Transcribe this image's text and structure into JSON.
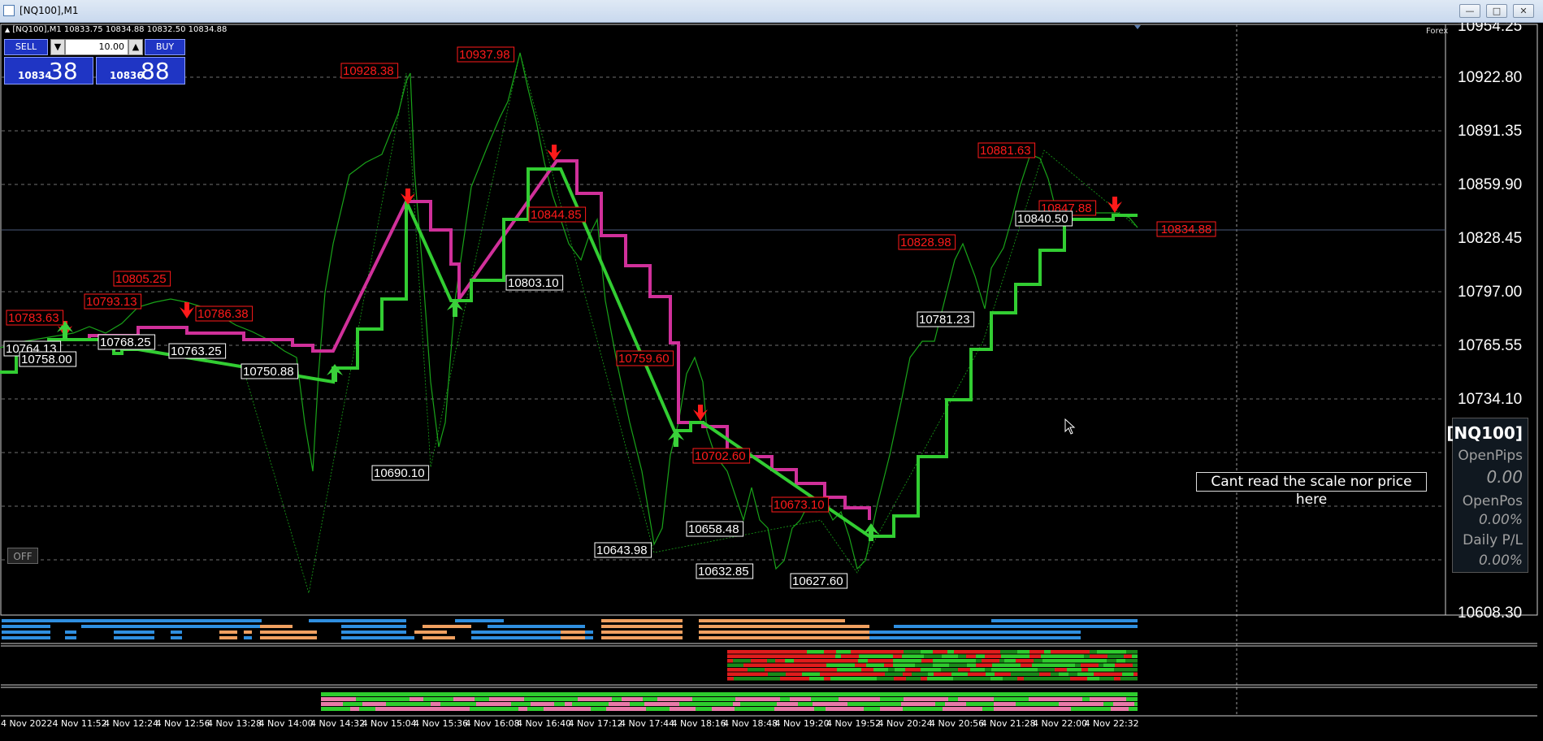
{
  "window": {
    "title": "[NQ100],M1"
  },
  "chart": {
    "header": "[NQ100],M1  10833.75 10834.88 10832.50 10834.88",
    "corner_label": "Forex"
  },
  "trade_panel": {
    "sell_label": "SELL",
    "buy_label": "BUY",
    "lot_size": "10.00",
    "bid_small": "10834",
    "bid_big": "38",
    "ask_small": "10836",
    "ask_big": "88"
  },
  "price_axis": {
    "top_partial": "10954.25",
    "labels": [
      "10922.80",
      "10891.35",
      "10859.90",
      "10828.45",
      "10797.00",
      "10765.55",
      "10734.10"
    ],
    "bottom_partial": "10608.30",
    "current_price": "10834.88"
  },
  "time_axis": {
    "labels": [
      "4 Nov 2022",
      "4 Nov 11:52",
      "4 Nov 12:24",
      "4 Nov 12:56",
      "4 Nov 13:28",
      "4 Nov 14:00",
      "4 Nov 14:32",
      "4 Nov 15:04",
      "4 Nov 15:36",
      "4 Nov 16:08",
      "4 Nov 16:40",
      "4 Nov 17:12",
      "4 Nov 17:44",
      "4 Nov 18:16",
      "4 Nov 18:48",
      "4 Nov 19:20",
      "4 Nov 19:52",
      "4 Nov 20:24",
      "4 Nov 20:56",
      "4 Nov 21:28",
      "4 Nov 22:00",
      "4 Nov 22:32"
    ]
  },
  "high_labels": [
    "10928.38",
    "10937.98",
    "10805.25",
    "10793.13",
    "10783.63",
    "10786.38",
    "10844.85",
    "10759.60",
    "10702.60",
    "10673.10",
    "10881.63",
    "10828.98",
    "10847.88"
  ],
  "low_labels": [
    "10764.13",
    "10768.25",
    "10758.00",
    "10763.25",
    "10750.88",
    "10690.10",
    "10803.10",
    "10643.98",
    "10658.48",
    "10632.85",
    "10627.60",
    "10781.23",
    "10840.50"
  ],
  "info_panel": {
    "symbol": "[NQ100]",
    "open_pips_label": "OpenPips",
    "open_pips_value": "0.00",
    "open_pos_label": "OpenPos",
    "open_pos_value": "0.00%",
    "daily_pl_label": "Daily P/L",
    "daily_pl_value": "0.00%"
  },
  "warning_text": "Cant read the scale nor price here",
  "off_button": "OFF",
  "colors": {
    "bull_step": "#32cd32",
    "bear_step": "#d0309a",
    "price_line": "#19a319",
    "high_label": "#ff1a1a",
    "sell_arrow": "#ff0000",
    "buy_arrow": "#3ad13a",
    "panel_blue": "#1f35c4"
  }
}
